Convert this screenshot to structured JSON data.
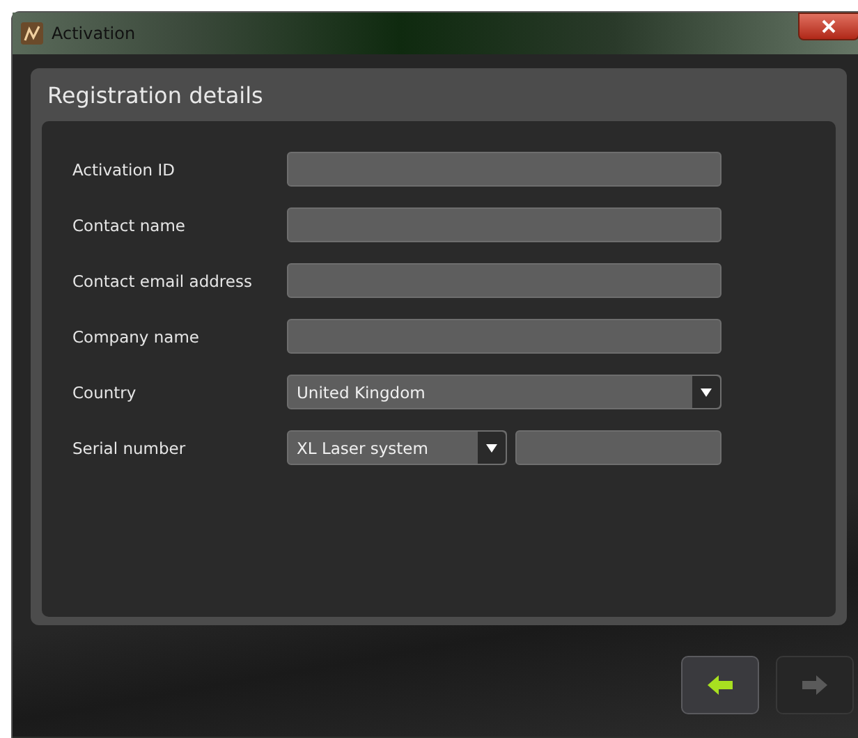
{
  "window": {
    "title": "Activation"
  },
  "panel": {
    "title": "Registration details"
  },
  "fields": [
    {
      "label": "Activation ID",
      "kind": "text"
    },
    {
      "label": "Contact name",
      "kind": "text"
    },
    {
      "label": "Contact email address",
      "kind": "text"
    },
    {
      "label": "Company name",
      "kind": "text"
    },
    {
      "label": "Country",
      "kind": "select",
      "value": "United Kingdom"
    },
    {
      "label": "Serial number",
      "kind": "select-text",
      "value": "XL Laser system"
    }
  ],
  "nav_buttons": [
    {
      "kind": "back",
      "disabled": false
    },
    {
      "kind": "next",
      "disabled": true
    }
  ]
}
